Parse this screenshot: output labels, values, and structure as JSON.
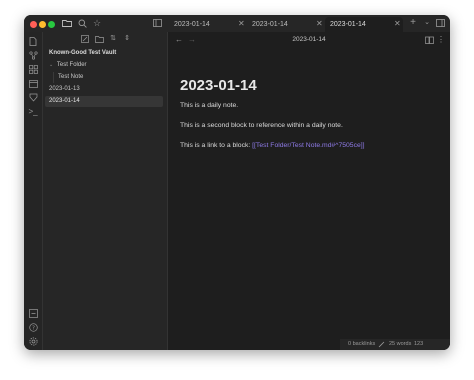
{
  "tabs": [
    {
      "label": "2023-01-14"
    },
    {
      "label": "2023-01-14"
    },
    {
      "label": "2023-01-14"
    }
  ],
  "vault_name": "Known-Good Test Vault",
  "file_tree": {
    "folder": "Test Folder",
    "folder_items": [
      "Test Note"
    ],
    "files": [
      "2023-01-13",
      "2023-01-14"
    ]
  },
  "view_header": {
    "title": "2023-01-14"
  },
  "note": {
    "title": "2023-01-14",
    "line1": "This is a daily note.",
    "line2": "This is a second block to reference within a daily note.",
    "line3_prefix": "This is a link to a block: ",
    "line3_link": "[[Test Folder/Test Note.md#^7505ce]]"
  },
  "status": {
    "backlinks": "0 backlinks",
    "words": "25 words",
    "characters": "123 characters"
  },
  "colors": {
    "link": "#8f7be8",
    "traffic_red": "#ff5f57",
    "traffic_yellow": "#febc2e",
    "traffic_green": "#28c840"
  }
}
